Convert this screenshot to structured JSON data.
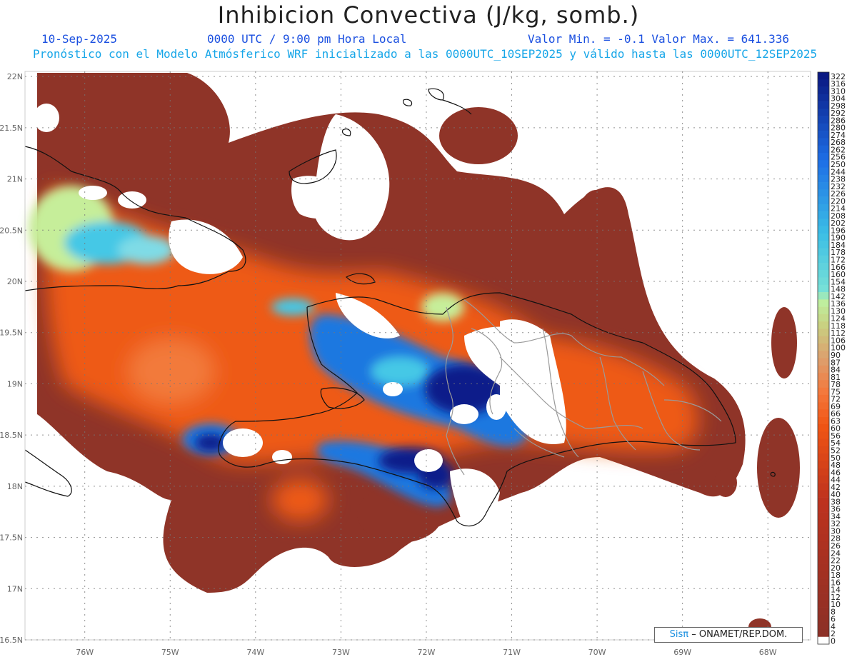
{
  "title": "Inhibicion Convectiva (J/kg, somb.)",
  "header": {
    "date": "10-Sep-2025",
    "time": "0000 UTC / 9:00 pm Hora Local",
    "minmax": "Valor Min. = -0.1  Valor Max. = 641.336",
    "subtitle": "Pronóstico con el Modelo Atmósferico WRF inicializado a las 0000UTC_10SEP2025 y válido hasta las  0000UTC_12SEP2025"
  },
  "map": {
    "lat_labels": [
      "22N",
      "21.5N",
      "21N",
      "20.5N",
      "20N",
      "19.5N",
      "19N",
      "18.5N",
      "18N",
      "17.5N",
      "17N",
      "16.5N"
    ],
    "lon_labels": [
      "76W",
      "75W",
      "74W",
      "73W",
      "72W",
      "71W",
      "70W",
      "69W",
      "68W"
    ],
    "lon_range": [
      -76.7,
      -67.5
    ],
    "lat_range": [
      16.5,
      22.05
    ],
    "colors": {
      "border_dark": "#8f3428",
      "orange": "#ee5a14",
      "light_orange": "#f27a3a",
      "green": "#c6ee9a",
      "cyan": "#45c8e6",
      "blue": "#1a78e0",
      "navy": "#0a1f8a",
      "coast": "#111111",
      "province": "#9a9a9a"
    }
  },
  "colorbar": {
    "labels": [
      "322",
      "316",
      "310",
      "304",
      "298",
      "292",
      "286",
      "280",
      "274",
      "268",
      "262",
      "256",
      "250",
      "244",
      "238",
      "232",
      "226",
      "220",
      "214",
      "208",
      "202",
      "196",
      "190",
      "184",
      "178",
      "172",
      "166",
      "160",
      "154",
      "148",
      "142",
      "136",
      "130",
      "124",
      "118",
      "112",
      "106",
      "100",
      "90",
      "87",
      "84",
      "81",
      "78",
      "75",
      "72",
      "69",
      "66",
      "63",
      "60",
      "56",
      "54",
      "52",
      "50",
      "48",
      "46",
      "44",
      "42",
      "40",
      "38",
      "36",
      "34",
      "32",
      "30",
      "28",
      "26",
      "24",
      "22",
      "20",
      "18",
      "16",
      "14",
      "12",
      "10",
      "8",
      "6",
      "4",
      "2",
      "0"
    ]
  },
  "credit": {
    "logo": "Sisπ",
    "text": "– ONAMET/REP.DOM."
  }
}
